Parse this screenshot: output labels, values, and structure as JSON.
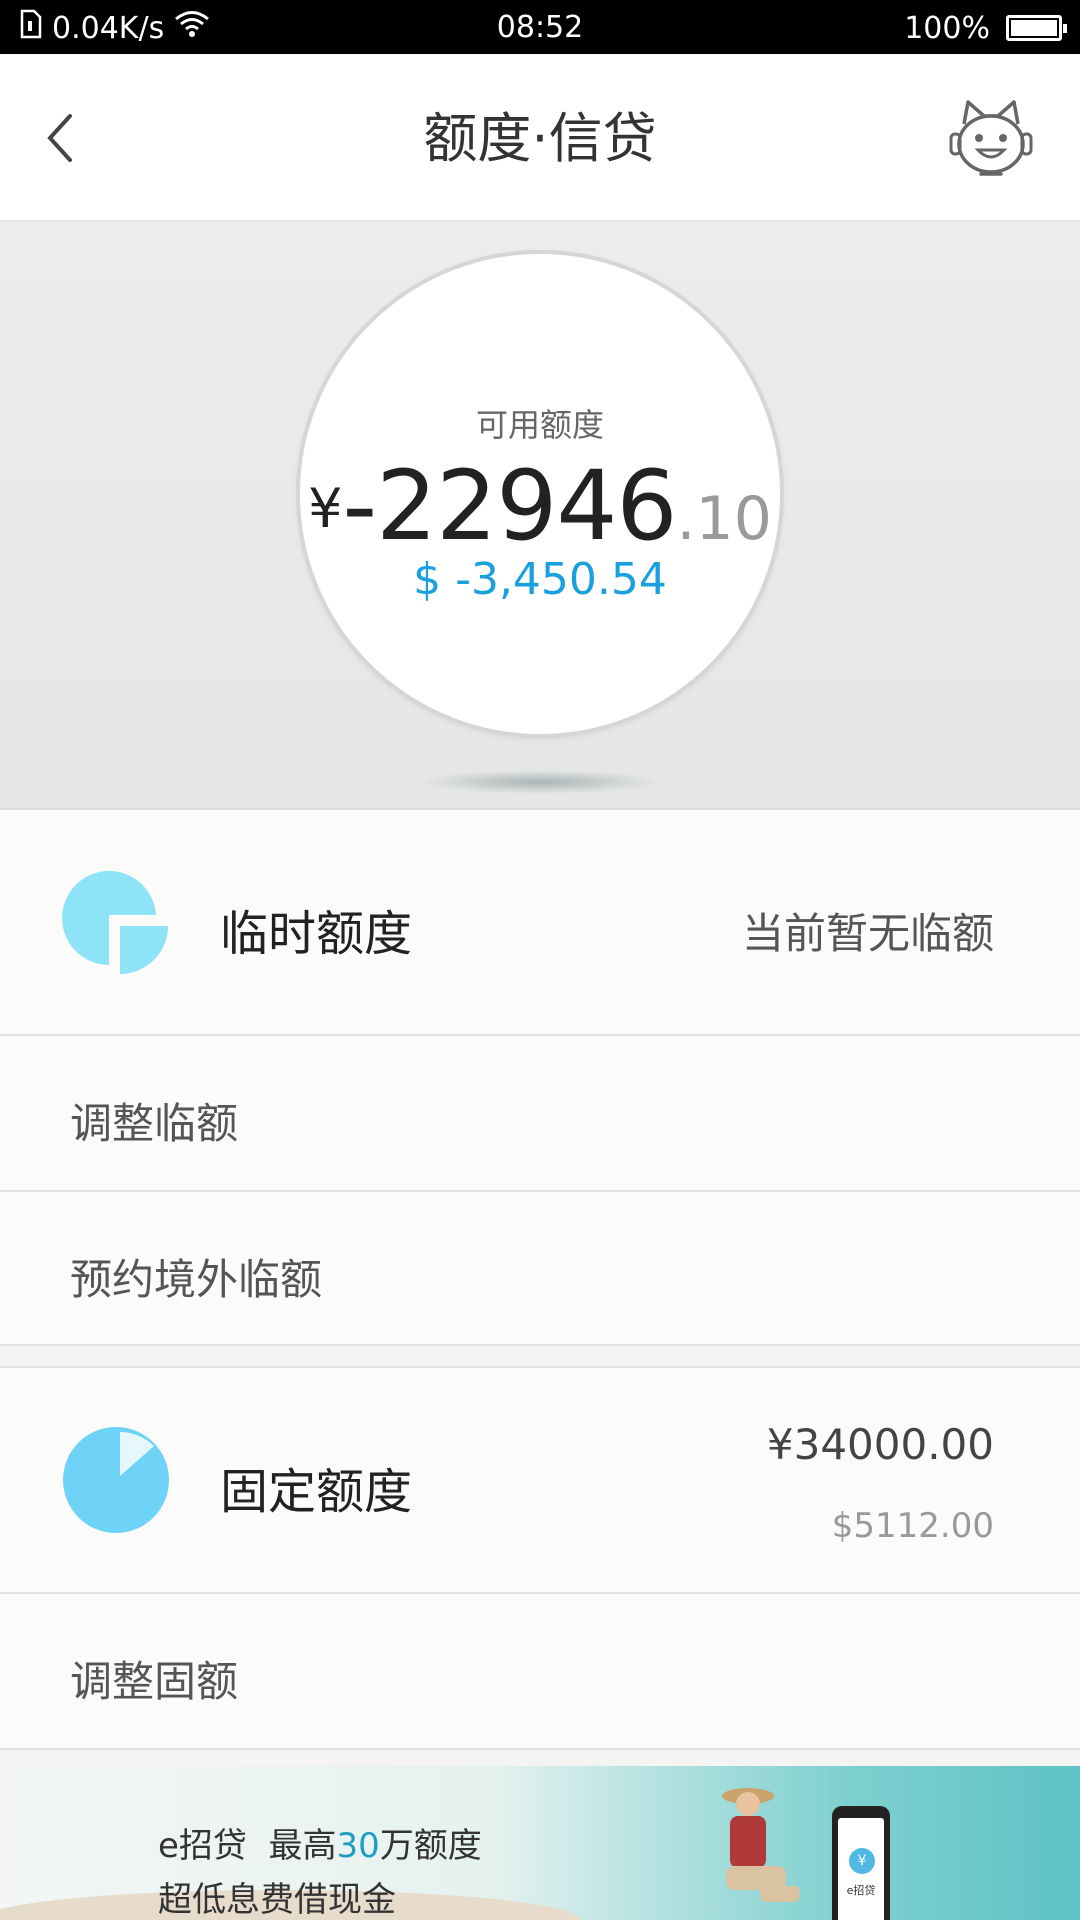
{
  "status_bar": {
    "speed": "0.04K/s",
    "time": "08:52",
    "battery": "100%",
    "battery_level": 1.0
  },
  "header": {
    "title": "额度·信贷",
    "back_icon": "chevron-left-icon",
    "assistant_icon": "robot-assistant-icon"
  },
  "balance": {
    "label": "可用额度",
    "currency_symbol": "¥",
    "integer_part": "-22946",
    "decimal_part": ".10",
    "usd_amount": "$ -3,450.54"
  },
  "temp_limit": {
    "title": "临时额度",
    "status": "当前暂无临额",
    "icon": "temporary-limit-icon",
    "links": [
      {
        "label": "调整临额"
      },
      {
        "label": "预约境外临额"
      }
    ]
  },
  "fixed_limit": {
    "title": "固定额度",
    "amount_cny": "¥34000.00",
    "amount_usd": "$5112.00",
    "icon": "fixed-limit-pie-icon",
    "links": [
      {
        "label": "调整固额"
      }
    ]
  },
  "banner": {
    "brand": "e招贷",
    "line1_prefix": "最高",
    "line1_highlight": "30",
    "line1_suffix": "万额度",
    "line2": "超低息费借现金",
    "phone_text": "e招贷"
  },
  "colors": {
    "accent_blue": "#1aa0df",
    "icon_light_blue": "#8ee4f6",
    "icon_blue": "#6ed3f7"
  }
}
